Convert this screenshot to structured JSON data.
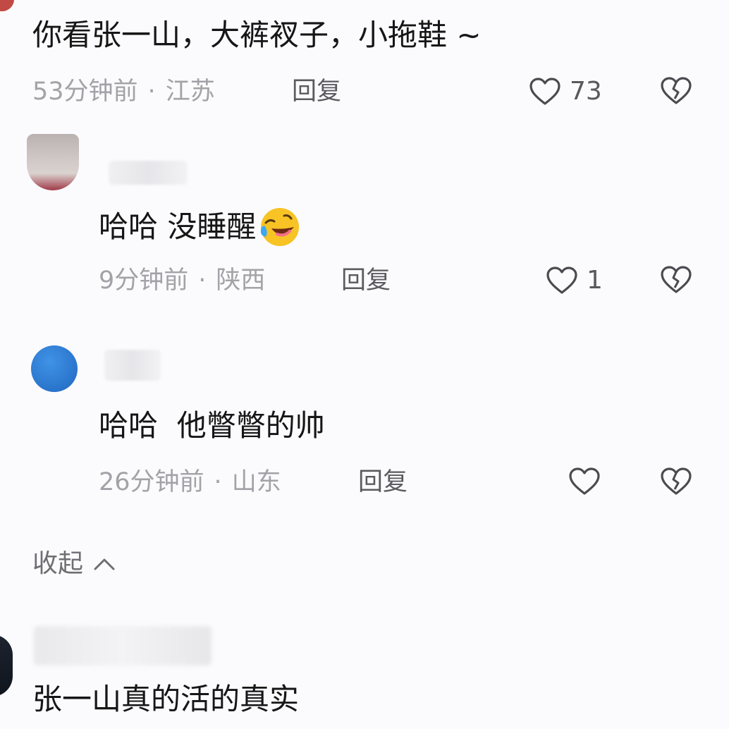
{
  "top_comment": {
    "text": "你看张一山，大裤衩子，小拖鞋 ~",
    "time": "53分钟前",
    "location": "江苏",
    "reply_label": "回复",
    "likes": "73"
  },
  "replies": [
    {
      "text": "哈哈 没睡醒",
      "emoji_icon": "laughing-crying-emoji",
      "time": "9分钟前",
      "location": "陕西",
      "reply_label": "回复",
      "likes": "1"
    },
    {
      "text": "哈哈  他瞥瞥的帅",
      "time": "26分钟前",
      "location": "山东",
      "reply_label": "回复",
      "likes": ""
    }
  ],
  "collapse_label": "收起",
  "next_comment": {
    "text": "张一山真的活的真实"
  },
  "colors": {
    "background": "#fbfbfd",
    "text": "#161616",
    "meta": "#a2a2a8",
    "avatar_blue": "#2f7fd6"
  }
}
